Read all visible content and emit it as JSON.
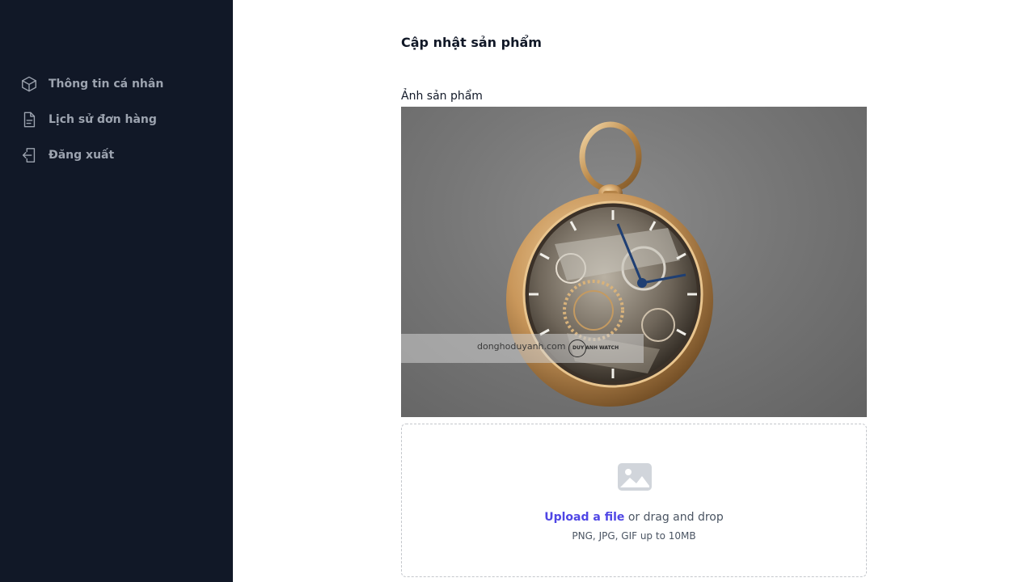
{
  "sidebar": {
    "items": [
      {
        "label": "Thông tin cá nhân",
        "icon": "cube-icon"
      },
      {
        "label": "Lịch sử đơn hàng",
        "icon": "document-icon"
      },
      {
        "label": "Đăng xuất",
        "icon": "logout-icon"
      }
    ],
    "background": "#111827",
    "text_color": "#9ca3af"
  },
  "main": {
    "title": "Cập nhật sản phẩm",
    "image_label": "Ảnh sản phẩm",
    "preview": {
      "watermark_text": "donghoduyanh.com",
      "watermark_brand": "DUY ANH WATCH"
    },
    "dropzone": {
      "icon": "image-icon",
      "upload_link": "Upload a file",
      "drag_text": " or drag and drop",
      "hint": "PNG, JPG, GIF up to 10MB",
      "link_color": "#4f46e5"
    }
  }
}
